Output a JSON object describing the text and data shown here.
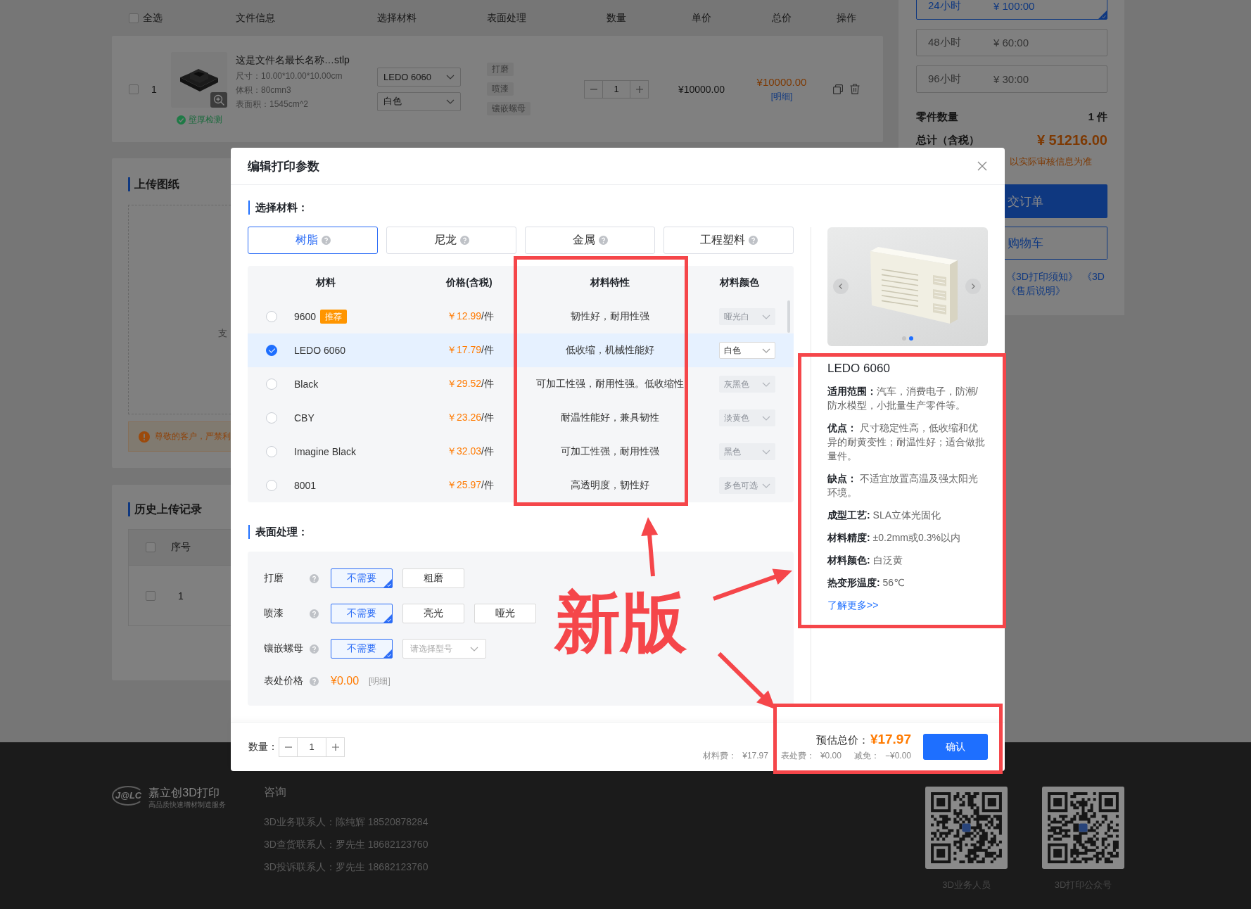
{
  "cart": {
    "select_all": {
      "label": "全选",
      "checked": false
    },
    "columns": [
      "文件信息",
      "选择材料",
      "表面处理",
      "数量",
      "单价",
      "总价",
      "操作"
    ],
    "rows": [
      {
        "checked": false,
        "index": "1",
        "file_name": "这是文件名最长名称…stlp",
        "details": [
          "尺寸：10.00*10.00*10.00cm",
          "体积：80cmn3",
          "表面积：1545cm^2"
        ],
        "wall_check": "壁厚检测",
        "material": "LEDO 6060",
        "material_color": "白色",
        "finishes": [
          "打磨",
          "喷漆",
          "镶嵌螺母"
        ],
        "quantity": "1",
        "unit_price": "¥10000.00",
        "total": "¥10000.00",
        "detail_link": "[明细]"
      }
    ]
  },
  "delivery": {
    "options": [
      {
        "time": "24小时",
        "price": "¥ 100:00",
        "selected": true
      },
      {
        "time": "48小时",
        "price": "¥ 60:00",
        "selected": false
      },
      {
        "time": "96小时",
        "price": "¥ 30:00",
        "selected": false
      }
    ],
    "part_count_label": "零件数量",
    "part_count": "1 件",
    "total_label": "总计（含税）",
    "total": "¥ 51216.00",
    "note": "以实际审核信息为准",
    "submit_button": "交订单",
    "cart_button": "购物车",
    "links": [
      [
        "《3D打印须知》",
        "《3D"
      ],
      [
        "《售后说明》"
      ]
    ]
  },
  "upload_card": {
    "title": "上传图纸",
    "hint": "支",
    "warning": "尊敬的客户，严禁利"
  },
  "history_card": {
    "title": "历史上传记录",
    "select_all": {
      "checked": false
    },
    "columns": [
      "序号"
    ],
    "rows": [
      {
        "checked": false,
        "index": "1"
      }
    ]
  },
  "edit_dialog": {
    "title": "编辑打印参数",
    "material_section": {
      "heading": "选择材料：",
      "tabs": [
        {
          "label": "树脂",
          "selected": true
        },
        {
          "label": "尼龙",
          "selected": false
        },
        {
          "label": "金属",
          "selected": false
        },
        {
          "label": "工程塑料",
          "selected": false
        }
      ],
      "table": {
        "columns": [
          "材料",
          "价格(含税)",
          "材料特性",
          "材料颜色"
        ],
        "rows": [
          {
            "selected": false,
            "name": "9600",
            "badge": "推荐",
            "price": "￥12.99",
            "unit": "/件",
            "property": "韧性好，耐用性强",
            "color_option": {
              "value": "哑光白",
              "disabled": true
            }
          },
          {
            "selected": true,
            "name": "LEDO 6060",
            "price": "￥17.79",
            "unit": "/件",
            "property": "低收缩，机械性能好",
            "color_option": {
              "value": "白色",
              "disabled": false
            }
          },
          {
            "selected": false,
            "name": "Black",
            "price": "￥29.52",
            "unit": "/件",
            "property": "可加工性强，耐用性强。低收缩性",
            "color_option": {
              "value": "灰黑色",
              "disabled": true
            }
          },
          {
            "selected": false,
            "name": "CBY",
            "price": "￥23.26",
            "unit": "/件",
            "property": "耐温性能好，兼具韧性",
            "color_option": {
              "value": "淡黄色",
              "disabled": true
            }
          },
          {
            "selected": false,
            "name": "Imagine Black",
            "price": "￥32.03",
            "unit": "/件",
            "property": "可加工性强，耐用性强",
            "color_option": {
              "value": "黑色",
              "disabled": true
            }
          },
          {
            "selected": false,
            "name": "8001",
            "price": "￥25.97",
            "unit": "/件",
            "property": "高透明度，韧性好",
            "color_option": {
              "value": "多色可选",
              "disabled": true
            }
          }
        ]
      }
    },
    "surface_section": {
      "heading": "表面处理：",
      "rows": [
        {
          "kind": "options",
          "label": "打磨",
          "options": [
            {
              "label": "不需要",
              "selected": true
            },
            {
              "label": "粗磨",
              "selected": false
            }
          ]
        },
        {
          "kind": "options",
          "label": "喷漆",
          "options": [
            {
              "label": "不需要",
              "selected": true
            },
            {
              "label": "亮光",
              "selected": false
            },
            {
              "label": "哑光",
              "selected": false
            }
          ]
        },
        {
          "kind": "options",
          "label": "镶嵌螺母",
          "options": [
            {
              "label": "不需要",
              "selected": true
            }
          ],
          "select": {
            "placeholder": "请选择型号"
          }
        },
        {
          "kind": "price",
          "label": "表处价格",
          "value": "¥0.00",
          "link": "[明细]"
        }
      ]
    },
    "product_info": {
      "carousel_dots": [
        {
          "selected": false
        },
        {
          "selected": true
        }
      ],
      "title": "LEDO 6060",
      "specs": [
        "**适用范围：**汽车，消费电子，防潮/防水模型，小批量生产零件等。",
        "**优点：** 尺寸稳定性高，低收缩和优异的耐黄变性；耐温性好；适合做批量件。",
        "**缺点：** 不适宜放置高温及强太阳光环境。",
        "**成型工艺:** SLA立体光固化",
        "**材料精度:** ±0.2mm或0.3%以内",
        "**材料颜色:** 白泛黄",
        "**热变形温度:** 56℃"
      ],
      "more_link": "了解更多>>"
    },
    "footer": {
      "quantity_label": "数量：",
      "quantity": "1",
      "estimate_label": "预估总价：",
      "estimate": "¥17.97",
      "fees": [
        {
          "label": "材料费：",
          "value": "¥17.97"
        },
        {
          "label": "表处费：",
          "value": "¥0.00"
        },
        {
          "label": "减免：",
          "value": "−¥0.00"
        }
      ],
      "confirm_button": "确认"
    }
  },
  "site_footer": {
    "logo_text": "J@LC",
    "brand": "嘉立创3D打印",
    "tagline": "高品质快速增材制造服务",
    "contact_heading": "咨询",
    "contacts": [
      "3D业务联系人：陈纯辉 18520878284",
      "3D查货联系人：罗先生 18682123760",
      "3D投诉联系人：罗先生 18682123760"
    ],
    "qr_codes": [
      {
        "caption": "3D业务人员"
      },
      {
        "caption": "3D打印公众号"
      }
    ]
  },
  "annotation": {
    "label": "新版"
  }
}
